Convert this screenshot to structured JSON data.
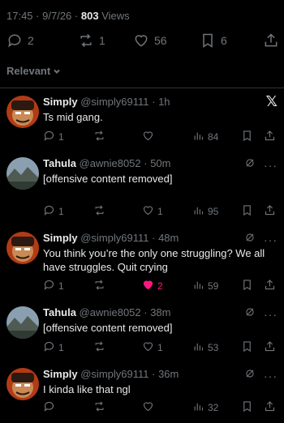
{
  "header": {
    "time": "17:45",
    "date": "9/7/26",
    "views_count": "803",
    "views_label": "Views"
  },
  "stats": {
    "replies": "2",
    "reposts": "1",
    "likes": "56",
    "bookmarks": "6"
  },
  "sort": {
    "label": "Relevant"
  },
  "replies": [
    {
      "name": "Simply",
      "handle": "@simply69111",
      "age": "1h",
      "text": "Ts mid gang.",
      "replies": "1",
      "reposts": "",
      "likes": "",
      "views": "84",
      "liked": false,
      "avatar": "fighter",
      "corner": "x-logo"
    },
    {
      "name": "Tahula",
      "handle": "@awnie8052",
      "age": "50m",
      "text": "[offensive content removed]",
      "replies": "1",
      "reposts": "",
      "likes": "1",
      "views": "95",
      "liked": false,
      "avatar": "landscape",
      "corner": "grok-dots"
    },
    {
      "name": "Simply",
      "handle": "@simply69111",
      "age": "48m",
      "text": "You think you’re the only one struggling? We all have struggles. Quit crying",
      "replies": "1",
      "reposts": "",
      "likes": "2",
      "views": "59",
      "liked": true,
      "avatar": "fighter",
      "corner": "grok-dots"
    },
    {
      "name": "Tahula",
      "handle": "@awnie8052",
      "age": "38m",
      "text": "[offensive content removed]",
      "replies": "1",
      "reposts": "",
      "likes": "1",
      "views": "53",
      "liked": false,
      "avatar": "landscape",
      "corner": "grok-dots"
    },
    {
      "name": "Simply",
      "handle": "@simply69111",
      "age": "36m",
      "text": "I kinda like that ngl",
      "replies": "",
      "reposts": "",
      "likes": "",
      "views": "32",
      "liked": false,
      "avatar": "fighter",
      "corner": "grok-dots"
    }
  ],
  "colors": {
    "background": "#000000",
    "text": "#e7e9ea",
    "muted": "#71767b",
    "divider": "#2f3336",
    "like_active": "#f91880"
  },
  "icons": {
    "reply": "speech-bubble-icon",
    "repost": "repost-arrows-icon",
    "like": "heart-icon",
    "bookmark": "bookmark-icon",
    "share": "share-upload-icon",
    "views": "bar-chart-icon",
    "grok": "grok-slash-circle-icon",
    "more": "more-dots-icon",
    "brand": "x-logo-icon"
  }
}
